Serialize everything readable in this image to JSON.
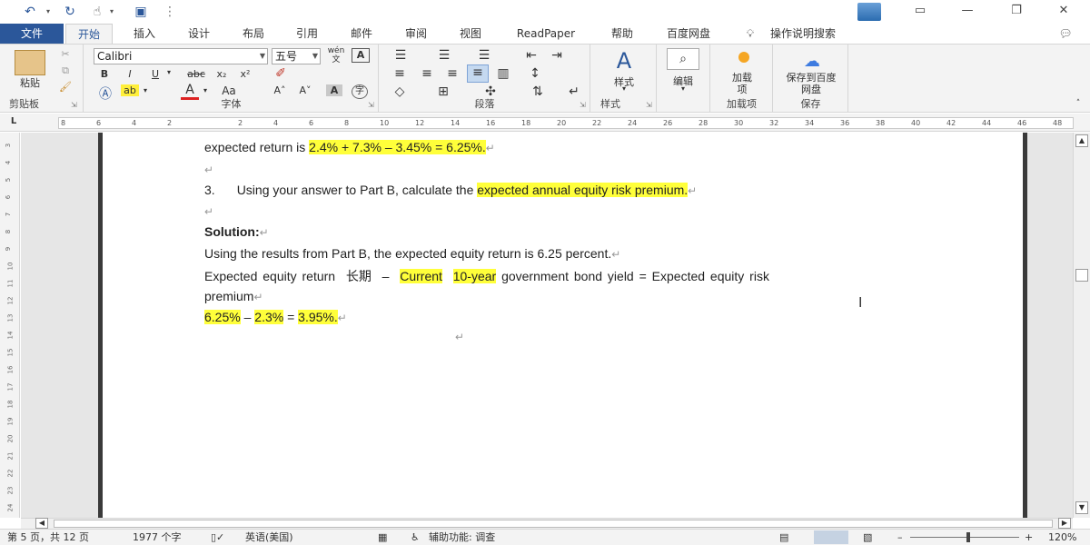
{
  "title_bar": {
    "undo_icon": "↶",
    "redo_icon": "↻",
    "touch_icon": "☝",
    "save_icon": "▣",
    "customize_icon": "⋮"
  },
  "menu": {
    "file": "文件",
    "tabs": [
      "开始",
      "插入",
      "设计",
      "布局",
      "引用",
      "邮件",
      "审阅",
      "视图",
      "ReadPaper",
      "帮助",
      "百度网盘"
    ],
    "search": "操作说明搜索"
  },
  "ribbon": {
    "clipboard": {
      "paste": "粘贴",
      "label": "剪贴板"
    },
    "font": {
      "family": "Calibri",
      "size": "五号",
      "label": "字体",
      "bold": "B",
      "italic": "I",
      "underline": "U",
      "strike": "abc",
      "sub": "x₂",
      "sup": "x²",
      "case": "Aa",
      "grow": "A˄",
      "shrink": "A˅",
      "wen": "wén 文"
    },
    "paragraph": {
      "label": "段落"
    },
    "styles": {
      "name": "样式",
      "label": "样式"
    },
    "editing": {
      "name": "编辑"
    },
    "addins": {
      "name": "加载项",
      "label": "加载项"
    },
    "save": {
      "name": "保存到百度网盘",
      "label": "保存"
    }
  },
  "ruler": {
    "ticks": [
      "8",
      "6",
      "4",
      "2",
      "",
      "2",
      "4",
      "6",
      "8",
      "10",
      "12",
      "14",
      "16",
      "18",
      "20",
      "22",
      "24",
      "26",
      "28",
      "30",
      "32",
      "34",
      "36",
      "38",
      "40",
      "42",
      "44",
      "46",
      "48"
    ]
  },
  "vruler": {
    "ticks": [
      "3",
      "4",
      "5",
      "6",
      "7",
      "8",
      "9",
      "10",
      "11",
      "12",
      "13",
      "14",
      "15",
      "16",
      "17",
      "18",
      "19",
      "20",
      "21",
      "22",
      "23",
      "24"
    ]
  },
  "document": {
    "line1_pre": "expected return is ",
    "line1_hl": "2.4% + 7.3% – 3.45% = 6.25%.",
    "line3_num": "3.",
    "line3_text": "Using your answer to Part B, calculate the ",
    "line3_hl": "expected annual equity risk premium.",
    "solution": "Solution:",
    "line5": "Using the results from Part B, the expected equity return is 6.25 percent.",
    "line6_a": "Expected equity return",
    "line6_cn": "长期",
    "line6_dash": "–",
    "line6_hl1": "Current",
    "line6_hl2": "10-year",
    "line6_b": "government bond yield = Expected equity risk",
    "line7": "premium",
    "line8_hl1": "6.25%",
    "line8_op": " – ",
    "line8_hl2": "2.3%",
    "line8_eq": " = ",
    "line8_hl3": "3.95%.",
    "pilcrow": "↵"
  },
  "status": {
    "page": "第 5 页，共 12 页",
    "words": "1977 个字",
    "lang": "英语(美国)",
    "accessibility": "辅助功能: 调查",
    "zoom": "120%",
    "minus": "–",
    "plus": "+"
  }
}
